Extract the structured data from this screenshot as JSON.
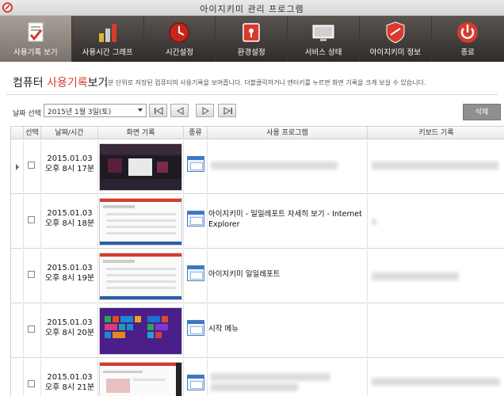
{
  "window": {
    "title": "아이지키미 관리 프로그램"
  },
  "toolbar": {
    "items": [
      {
        "label": "사용기록 보기",
        "icon": "record-check-icon",
        "active": true
      },
      {
        "label": "사용시간 그래프",
        "icon": "bar-graph-icon"
      },
      {
        "label": "시간설정",
        "icon": "clock-icon"
      },
      {
        "label": "환경설정",
        "icon": "lock-settings-icon"
      },
      {
        "label": "서비스 상태",
        "icon": "monitor-icon"
      },
      {
        "label": "아이지키미 정보",
        "icon": "shield-icon"
      },
      {
        "label": "종료",
        "icon": "power-icon"
      }
    ]
  },
  "header": {
    "title_prefix": "컴퓨터 ",
    "title_highlight": "사용기록",
    "title_suffix": "보기",
    "description": "1분 단위로 저장된 컴퓨터의 사용기록을 보여줍니다. 더블클릭하거나 엔터키를 누르면 화면 기록을 크게 보실 수 있습니다."
  },
  "controls": {
    "date_label": "날짜 선택",
    "date_value": "2015년 1월 3일(토)",
    "delete_label": "삭제"
  },
  "grid": {
    "columns": [
      "선택",
      "날짜/시간",
      "화면 기록",
      "종류",
      "사용 프로그램",
      "키보드 기록"
    ],
    "rows": [
      {
        "date": "2015.01.03",
        "time": "오후 8시 17분",
        "program": "",
        "current": true
      },
      {
        "date": "2015.01.03",
        "time": "오후 8시 18분",
        "program": "아이지키미 - 일일레포트 자세히 보기 - Internet Explorer"
      },
      {
        "date": "2015.01.03",
        "time": "오후 8시 19분",
        "program": "아이지키미 일일레포트"
      },
      {
        "date": "2015.01.03",
        "time": "오후 8시 20분",
        "program": "시작 메뉴"
      },
      {
        "date": "2015.01.03",
        "time": "오후 8시 21분",
        "program": ""
      }
    ]
  },
  "colors": {
    "accent": "#d83a2e",
    "toolbar_dark": "#2f2c2a",
    "toolbar_active": "#8a827a",
    "row_icon": "#3b78c6"
  }
}
